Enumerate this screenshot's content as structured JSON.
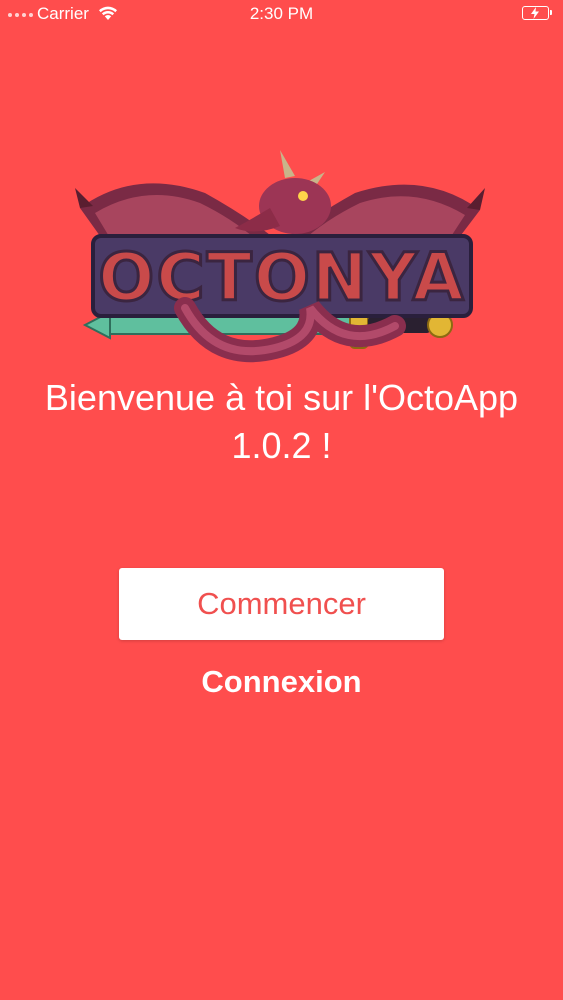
{
  "status_bar": {
    "carrier": "Carrier",
    "time": "2:30 PM",
    "wifi_icon": "wifi-icon",
    "battery_icon": "battery-charging-icon"
  },
  "logo": {
    "text": "OCTONYA",
    "icon": "dragon-logo"
  },
  "welcome": {
    "line1": "Bienvenue à toi sur l'OctoApp",
    "line2": "1.0.2 !"
  },
  "actions": {
    "start_label": "Commencer",
    "login_label": "Connexion"
  },
  "colors": {
    "background": "#ff4d4d",
    "button_text": "#f0504f",
    "button_bg": "#ffffff"
  }
}
